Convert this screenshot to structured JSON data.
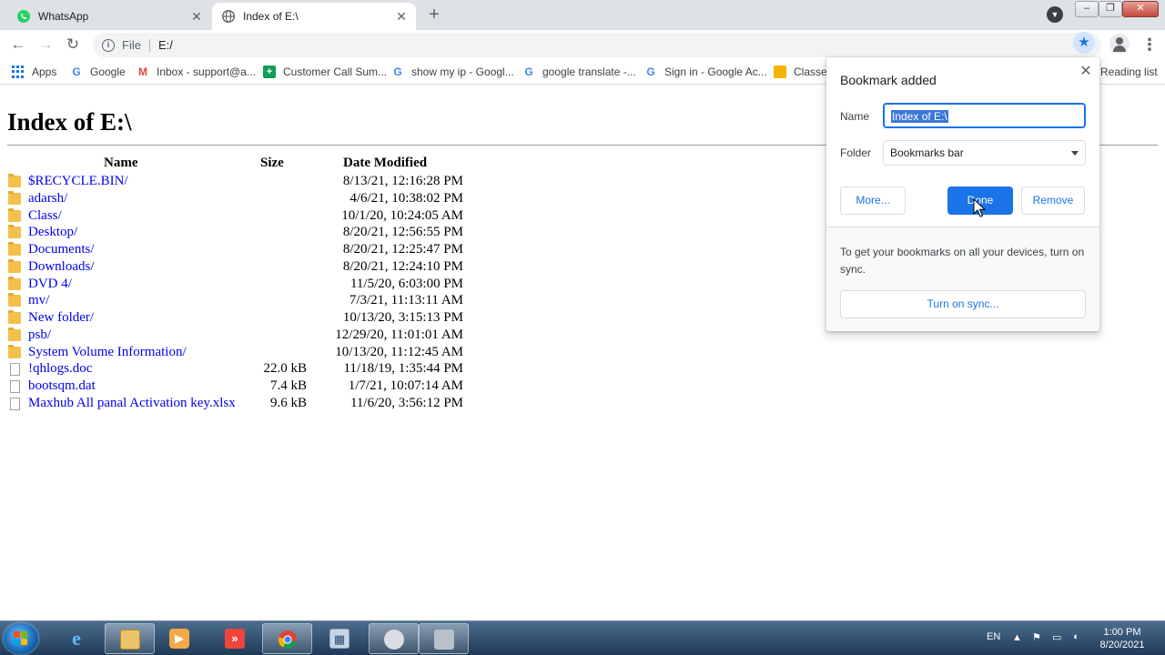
{
  "tabs": [
    {
      "title": "WhatsApp",
      "icon": "whatsapp-icon"
    },
    {
      "title": "Index of E:\\",
      "icon": "globe-icon"
    }
  ],
  "omnibox": {
    "scheme": "File",
    "url": "E:/"
  },
  "bookmarks": [
    {
      "label": "Apps",
      "icon": "apps-grid-icon"
    },
    {
      "label": "Google",
      "icon": "google-icon"
    },
    {
      "label": "Inbox - support@a...",
      "icon": "gmail-icon"
    },
    {
      "label": "Customer Call Sum...",
      "icon": "sheets-icon"
    },
    {
      "label": "show my ip - Googl...",
      "icon": "google-icon"
    },
    {
      "label": "google translate -...",
      "icon": "google-icon"
    },
    {
      "label": "Sign in - Google Ac...",
      "icon": "google-icon"
    },
    {
      "label": "Classes",
      "icon": "classroom-icon"
    },
    {
      "label": "Reading list",
      "icon": "reading-list-icon"
    }
  ],
  "page": {
    "heading": "Index of E:\\",
    "columns": {
      "name": "Name",
      "size": "Size",
      "date": "Date Modified"
    },
    "entries": [
      {
        "name": "$RECYCLE.BIN/",
        "size": "",
        "date": "8/13/21, 12:16:28 PM",
        "type": "folder"
      },
      {
        "name": "adarsh/",
        "size": "",
        "date": "4/6/21, 10:38:02 PM",
        "type": "folder"
      },
      {
        "name": "Class/",
        "size": "",
        "date": "10/1/20, 10:24:05 AM",
        "type": "folder"
      },
      {
        "name": "Desktop/",
        "size": "",
        "date": "8/20/21, 12:56:55 PM",
        "type": "folder"
      },
      {
        "name": "Documents/",
        "size": "",
        "date": "8/20/21, 12:25:47 PM",
        "type": "folder"
      },
      {
        "name": "Downloads/",
        "size": "",
        "date": "8/20/21, 12:24:10 PM",
        "type": "folder"
      },
      {
        "name": "DVD 4/",
        "size": "",
        "date": "11/5/20, 6:03:00 PM",
        "type": "folder"
      },
      {
        "name": "mv/",
        "size": "",
        "date": "7/3/21, 11:13:11 AM",
        "type": "folder"
      },
      {
        "name": "New folder/",
        "size": "",
        "date": "10/13/20, 3:15:13 PM",
        "type": "folder"
      },
      {
        "name": "psb/",
        "size": "",
        "date": "12/29/20, 11:01:01 AM",
        "type": "folder"
      },
      {
        "name": "System Volume Information/",
        "size": "",
        "date": "10/13/20, 11:12:45 AM",
        "type": "folder"
      },
      {
        "name": "!qhlogs.doc",
        "size": "22.0 kB",
        "date": "11/18/19, 1:35:44 PM",
        "type": "file"
      },
      {
        "name": "bootsqm.dat",
        "size": "7.4 kB",
        "date": "1/7/21, 10:07:14 AM",
        "type": "file"
      },
      {
        "name": "Maxhub All panal Activation key.xlsx",
        "size": "9.6 kB",
        "date": "11/6/20, 3:56:12 PM",
        "type": "file"
      }
    ]
  },
  "bookmark_bubble": {
    "title": "Bookmark added",
    "name_label": "Name",
    "name_value": "Index of E:\\",
    "folder_label": "Folder",
    "folder_value": "Bookmarks bar",
    "more_label": "More...",
    "done_label": "Done",
    "remove_label": "Remove",
    "sync_text": "To get your bookmarks on all your devices, turn on sync.",
    "sync_button": "Turn on sync..."
  },
  "taskbar": {
    "apps": [
      "internet-explorer-icon",
      "file-explorer-icon",
      "media-player-icon",
      "anydesk-icon",
      "chrome-icon",
      "calculator-icon",
      "app-icon",
      "app-icon-2"
    ],
    "language": "EN",
    "time": "1:00 PM",
    "date": "8/20/2021"
  },
  "colors": {
    "accent": "#1a73e8",
    "link": "#0000ee",
    "tabstrip": "#dee1e6"
  }
}
